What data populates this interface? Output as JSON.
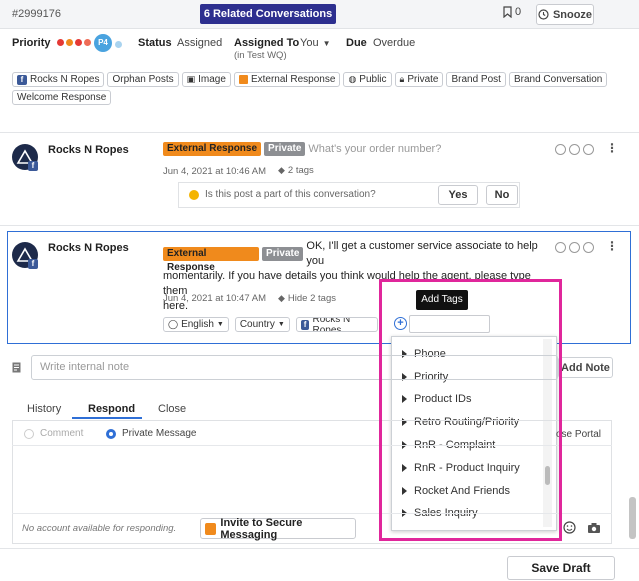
{
  "header": {
    "case_id": "#2999176",
    "related_conversations": "6 Related Conversations",
    "bookmark_count": "0",
    "snooze_label": "Snooze"
  },
  "meta": {
    "priority_label": "Priority",
    "priority_badge": "P4",
    "priority_colors": [
      "#e53935",
      "#f08a1c",
      "#e53935",
      "#ef6c57",
      "#4aa3df",
      "#a9d3ef"
    ],
    "status_label": "Status",
    "status_value": "Assigned",
    "assigned_label": "Assigned To",
    "assigned_value": "You",
    "assigned_sub": "(in Test WQ)",
    "due_label": "Due",
    "due_value": "Overdue"
  },
  "tags": [
    "Rocks N Ropes",
    "Orphan Posts",
    "Image",
    "External Response",
    "Public",
    "Private",
    "Brand Post",
    "Brand Conversation",
    "Welcome Response"
  ],
  "post1": {
    "author": "Rocks N Ropes",
    "badge_ext": "External Response",
    "badge_priv": "Private",
    "message": "What's your order number?",
    "date": "Jun 4, 2021 at 10:46 AM",
    "tag_count": "2 tags",
    "question": "Is this post a part of this conversation?",
    "yes": "Yes",
    "no": "No"
  },
  "post2": {
    "author": "Rocks N Ropes",
    "badge_ext": "External Response",
    "badge_priv": "Private",
    "message_line1": "OK, I'll get a customer service associate to help you",
    "message_line2": "momentarily. If you have details you think would help the agent, please type them",
    "message_line3": "here.",
    "date": "Jun 4, 2021 at 10:47 AM",
    "hide_tags": "Hide 2 tags",
    "language": "English",
    "country": "Country",
    "account": "Rocks N Ropes"
  },
  "tag_picker": {
    "tooltip": "Add Tags",
    "items": [
      "Phone",
      "Priority",
      "Product IDs",
      "Retro Routing/Priority",
      "RnR - Complaint",
      "RnR - Product Inquiry",
      "Rocket And Friends",
      "Sales Inquiry"
    ]
  },
  "composer": {
    "note_placeholder": "Write internal note",
    "add_note": "Add Note",
    "tabs": [
      "History",
      "Respond",
      "Close"
    ],
    "radio_comment": "Comment",
    "radio_private": "Private Message",
    "choose_portal": "ose Portal",
    "no_account": "No account available for responding.",
    "invite_secure": "Invite to Secure Messaging",
    "save_draft": "Save Draft"
  }
}
